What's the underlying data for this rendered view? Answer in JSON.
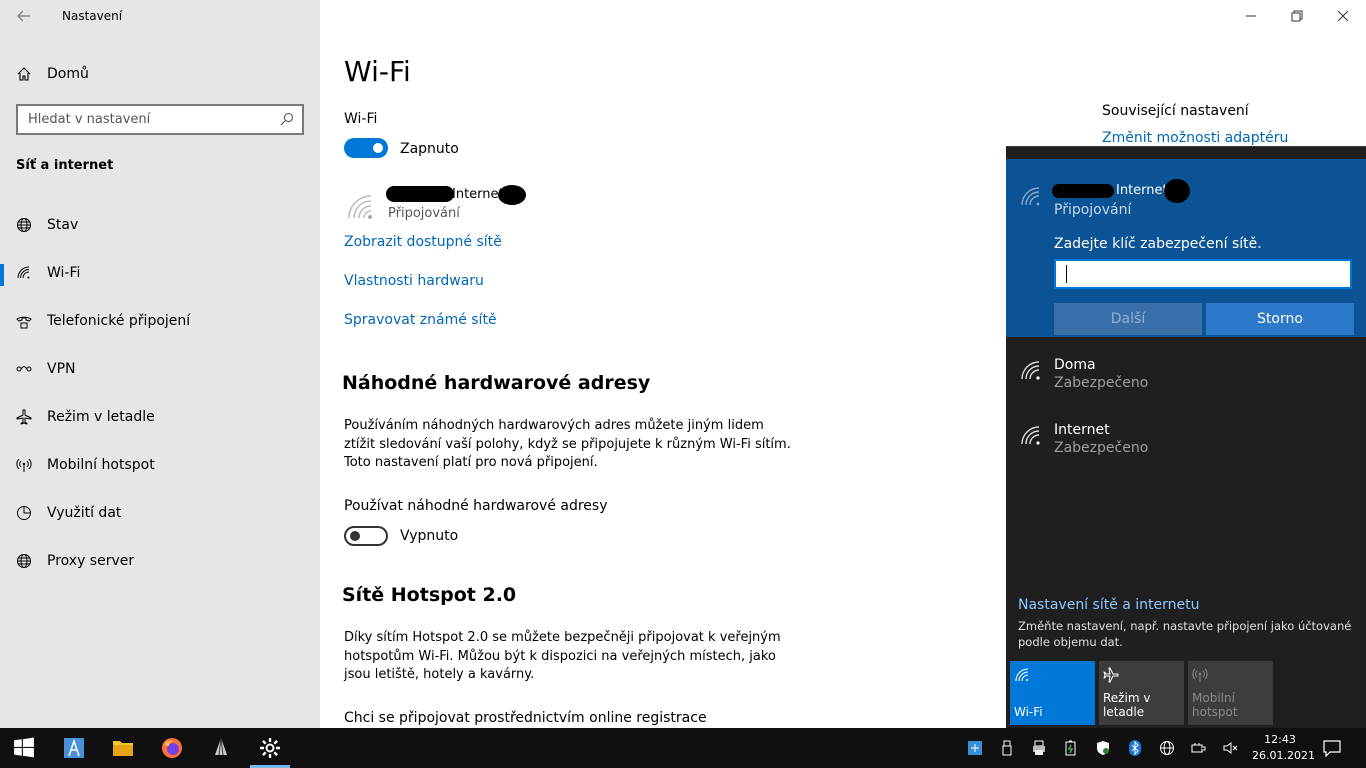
{
  "window": {
    "app_title": "Nastavení",
    "minimize": "—",
    "maximize": "❐",
    "close": "✕"
  },
  "sidebar": {
    "home_label": "Domů",
    "search_placeholder": "Hledat v nastavení",
    "section_title": "Síť a internet",
    "items": [
      {
        "label": "Stav",
        "icon": "globe-icon"
      },
      {
        "label": "Wi-Fi",
        "icon": "wifi-icon",
        "selected": true
      },
      {
        "label": "Telefonické připojení",
        "icon": "dialup-icon"
      },
      {
        "label": "VPN",
        "icon": "vpn-icon"
      },
      {
        "label": "Režim v letadle",
        "icon": "airplane-icon"
      },
      {
        "label": "Mobilní hotspot",
        "icon": "hotspot-icon"
      },
      {
        "label": "Využití dat",
        "icon": "data-usage-icon"
      },
      {
        "label": "Proxy server",
        "icon": "globe-icon"
      }
    ]
  },
  "main": {
    "title": "Wi-Fi",
    "wifi_label": "Wi-Fi",
    "wifi_toggle_state": "Zapnuto",
    "network_name": "Internet",
    "network_status": "Připojování",
    "links": {
      "show_networks": "Zobrazit dostupné sítě",
      "hardware_properties": "Vlastnosti hardwaru",
      "manage_known": "Spravovat známé sítě"
    },
    "random_hw": {
      "heading": "Náhodné hardwarové adresy",
      "description": "Používáním náhodných hardwarových adres můžete jiným lidem ztížit sledování vaší polohy, když se připojujete k různým Wi-Fi sítím. Toto nastavení platí pro nová připojení.",
      "toggle_label": "Používat náhodné hardwarové adresy",
      "toggle_state": "Vypnuto"
    },
    "hotspot20": {
      "heading": "Sítě Hotspot 2.0",
      "description": "Díky sítím Hotspot 2.0 se můžete bezpečněji připojovat k veřejným hotspotům Wi-Fi. Můžou být k dispozici na veřejných místech, jako jsou letiště, hotely a kavárny.",
      "online_reg": "Chci se připojovat prostřednictvím online registrace"
    },
    "related": {
      "title": "Související nastavení",
      "adapter_link": "Změnit možnosti adaptéru"
    }
  },
  "flyout": {
    "active_network": {
      "name": "Internet",
      "status": "Připojování",
      "key_prompt": "Zadejte klíč zabezpečení sítě.",
      "key_value": "",
      "next_label": "Další",
      "cancel_label": "Storno"
    },
    "networks": [
      {
        "name": "Doma",
        "status": "Zabezpečeno"
      },
      {
        "name": "Internet",
        "status": "Zabezpečeno"
      }
    ],
    "settings_link": "Nastavení sítě a internetu",
    "settings_desc": "Změňte nastavení, např. nastavte připojení jako účtované podle objemu dat.",
    "tiles": {
      "wifi": "Wi-Fi",
      "airplane": "Režim v letadle",
      "hotspot": "Mobilní hotspot"
    }
  },
  "taskbar": {
    "time": "12:43",
    "date": "26.01.2021"
  },
  "colors": {
    "accent": "#0078d7",
    "link": "#0067b8",
    "flyout_bg": "#1f1f1f",
    "flyout_active": "#0b5394"
  }
}
